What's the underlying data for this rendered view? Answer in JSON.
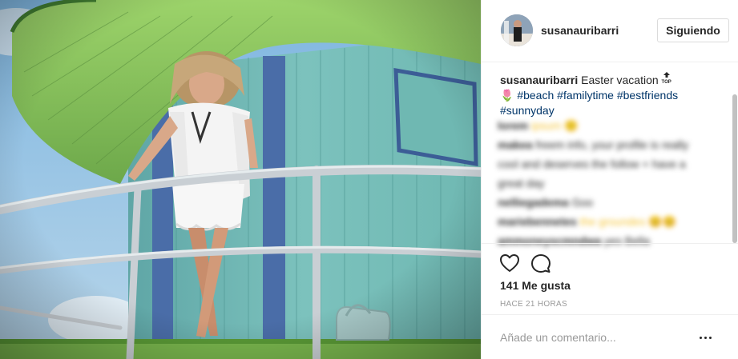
{
  "post": {
    "photo_alt": "",
    "author": {
      "username": "susanauribarri",
      "follow_label": "Siguiendo"
    },
    "caption": {
      "username": "susanauribarri",
      "text": "Easter vacation",
      "top_emoji_label": "TOP",
      "tulip_emoji": "🌷",
      "hashtags": [
        "#beach",
        "#familytime",
        "#bestfriends",
        "#sunnyday"
      ]
    },
    "blurred_comments": [
      {
        "user": "lorem",
        "text": "ipsum 🙂"
      },
      {
        "user": "makea",
        "text": "freem info, your profile is really"
      },
      {
        "user": "",
        "text": "cool and deserves the follow + have a"
      },
      {
        "user": "",
        "text": "great day"
      },
      {
        "user": "nelliegadema",
        "text": "Goo"
      },
      {
        "user": "mariebennetes",
        "text": "the groundes 😊😊"
      },
      {
        "user": "ammoneyscmndwa",
        "text": "yes Bella"
      }
    ],
    "likes_text": "141 Me gusta",
    "time_text": "HACE 21 HORAS",
    "comment_placeholder": "Añade un comentario...",
    "icons": {
      "like": "heart-icon",
      "comment": "comment-bubble-icon",
      "more": "more-options-icon"
    },
    "colors": {
      "hashtag": "#003569",
      "text": "#262626",
      "muted": "#999999",
      "border": "#efefef"
    }
  }
}
